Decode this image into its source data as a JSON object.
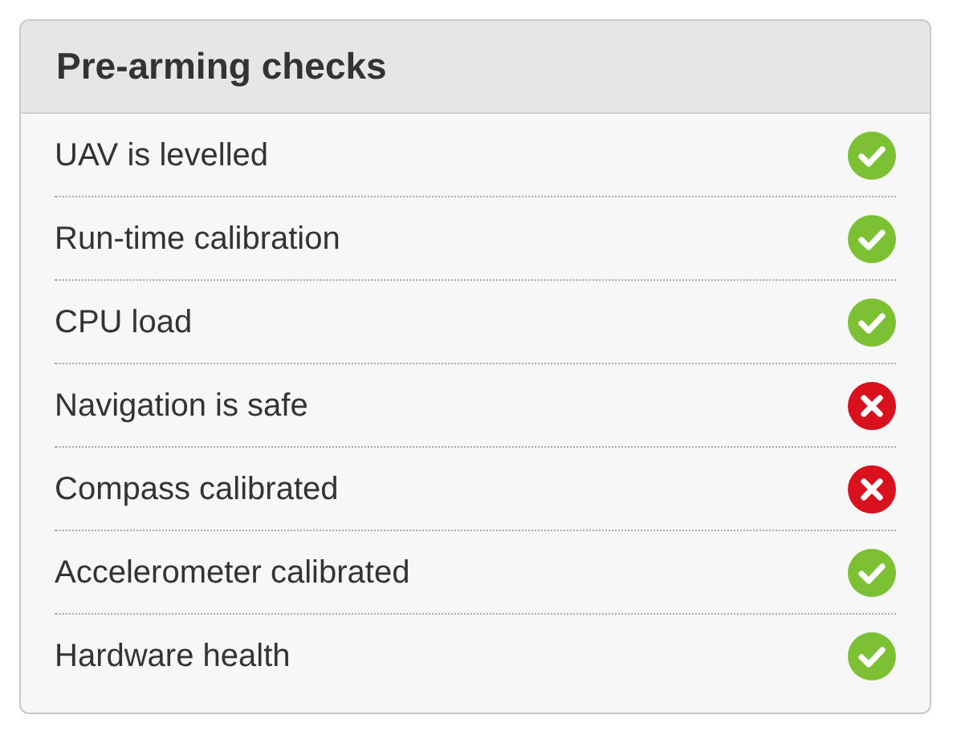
{
  "panel": {
    "title": "Pre-arming checks"
  },
  "checks": [
    {
      "label": "UAV is levelled",
      "passed": true
    },
    {
      "label": "Run-time calibration",
      "passed": true
    },
    {
      "label": "CPU load",
      "passed": true
    },
    {
      "label": "Navigation is safe",
      "passed": false
    },
    {
      "label": "Compass calibrated",
      "passed": false
    },
    {
      "label": "Accelerometer calibrated",
      "passed": true
    },
    {
      "label": "Hardware health",
      "passed": true
    }
  ]
}
